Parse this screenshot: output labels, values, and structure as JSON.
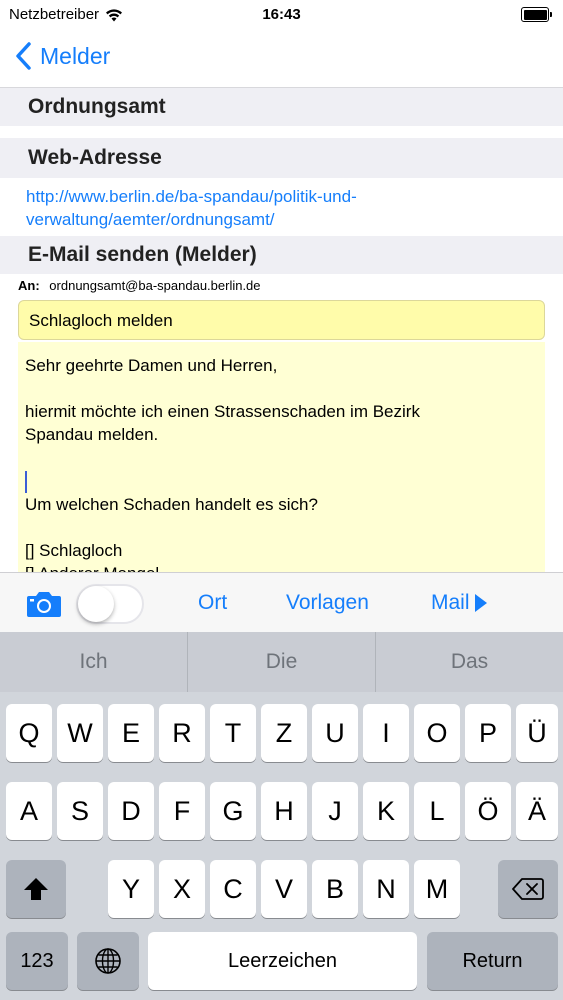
{
  "status": {
    "carrier": "Netzbetreiber",
    "time": "16:43"
  },
  "nav": {
    "back_label": "Melder"
  },
  "sections": {
    "ordnungsamt": "Ordnungsamt",
    "web_header": "Web-Adresse",
    "web_link": "http://www.berlin.de/ba-spandau/politik-und-verwaltung/aemter/ordnungsamt/",
    "mail_header": "E-Mail senden (Melder)"
  },
  "email": {
    "to_label": "An:",
    "to_value": "ordnungsamt@ba-spandau.berlin.de",
    "subject": "Schlagloch melden",
    "body_lines": [
      "Sehr geehrte Damen und Herren,",
      "",
      "hiermit möchte ich einen Strassenschaden im Bezirk",
      "Spandau melden.",
      "",
      "",
      "Um welchen Schaden handelt es sich?",
      "",
      "[] Schlagloch",
      "[] Anderer Mangel"
    ]
  },
  "toolbar": {
    "ort": "Ort",
    "vorlagen": "Vorlagen",
    "mail": "Mail",
    "toggle_on": false
  },
  "keyboard": {
    "suggestions": [
      "Ich",
      "Die",
      "Das"
    ],
    "row1": [
      "Q",
      "W",
      "E",
      "R",
      "T",
      "Z",
      "U",
      "I",
      "O",
      "P",
      "Ü"
    ],
    "row2": [
      "A",
      "S",
      "D",
      "F",
      "G",
      "H",
      "J",
      "K",
      "L",
      "Ö",
      "Ä"
    ],
    "row3": [
      "Y",
      "X",
      "C",
      "V",
      "B",
      "N",
      "M"
    ],
    "numbers_key": "123",
    "space_key": "Leerzeichen",
    "return_key": "Return"
  },
  "colors": {
    "accent": "#157efb",
    "subject_bg": "#fffcaa",
    "body_bg": "#ffffd4"
  }
}
